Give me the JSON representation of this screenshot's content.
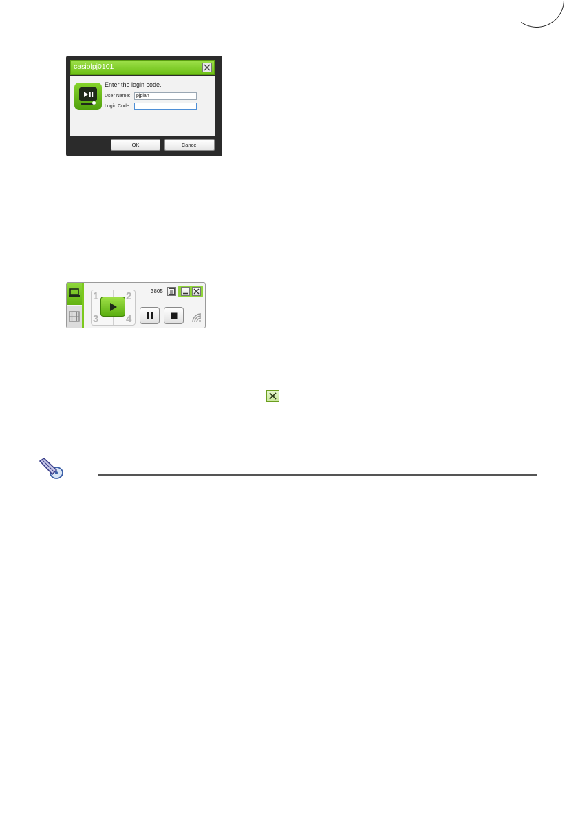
{
  "login_dialog": {
    "title": "casiolpj0101",
    "prompt": "Enter the login code.",
    "user_name_label": "User Name:",
    "user_name_value": "pjplan",
    "login_code_label": "Login Code:",
    "login_code_value": "",
    "ok_label": "OK",
    "cancel_label": "Cancel",
    "accent_color": "#7cc91d",
    "icon": "play-pause-display-icon"
  },
  "controller": {
    "login_code": "3805",
    "pad_numbers": [
      "1",
      "2",
      "3",
      "4"
    ],
    "tabs": [
      "display-tab-icon",
      "movie-tab-icon"
    ],
    "controls": [
      "play-icon",
      "pause-icon",
      "stop-icon",
      "signal-icon"
    ],
    "accent_color": "#7cc91d"
  },
  "inline_icon": "close-icon",
  "note": {
    "icon": "memo-pencil-icon"
  }
}
